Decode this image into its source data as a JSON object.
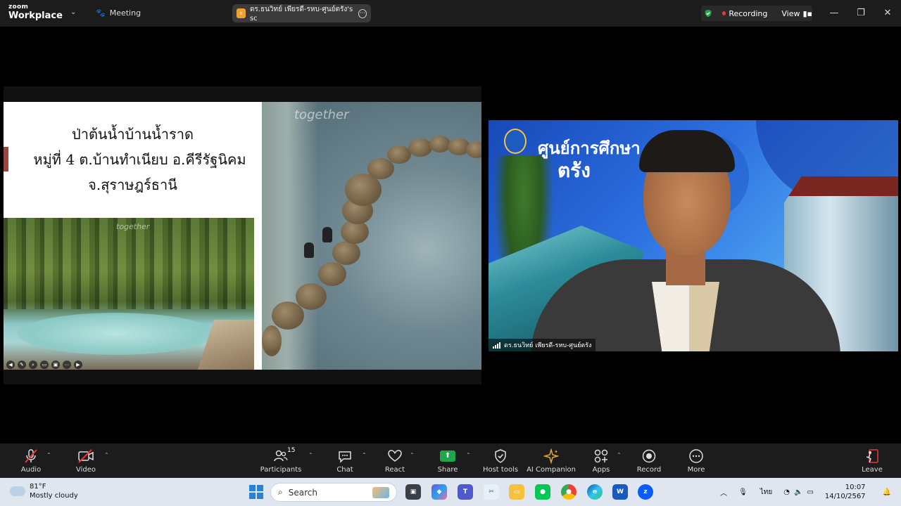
{
  "titlebar": {
    "brand_top": "zoom",
    "brand_bottom": "Workplace",
    "meeting_label": "Meeting",
    "share_title": "ดร.ธนวิทย์ เพียรดี-รหบ-ศูนย์ตรัง's sc",
    "share_badge": "ธ",
    "recording_label": "Recording",
    "view_label": "View",
    "minimize": "—",
    "restore": "❐",
    "close": "✕"
  },
  "slide": {
    "line1": "ป่าต้นน้ำบ้านน้ำราด",
    "line2": "หมู่ที่ 4 ต.บ้านทำเนียบ อ.คีรีรัฐนิคม",
    "line3": "จ.สุราษฎร์ธานี",
    "watermark_big": "together",
    "watermark_small": "together"
  },
  "video": {
    "bg_title1": "ศูนย์การศึกษา",
    "bg_title2": "ตรัง",
    "participant_name": "ดร.ธนวิทย์ เพียรดี-รหบ-ศูนย์ตรัง"
  },
  "toolbar": {
    "audio": "Audio",
    "video": "Video",
    "participants": "Participants",
    "participants_count": "15",
    "chat": "Chat",
    "react": "React",
    "share": "Share",
    "host_tools": "Host tools",
    "ai_companion": "AI Companion",
    "apps": "Apps",
    "record": "Record",
    "more": "More",
    "leave": "Leave"
  },
  "taskbar": {
    "weather_temp": "81°F",
    "weather_desc": "Mostly cloudy",
    "search_placeholder": "Search",
    "language": "ไทย",
    "time": "10:07",
    "date": "14/10/2567"
  }
}
